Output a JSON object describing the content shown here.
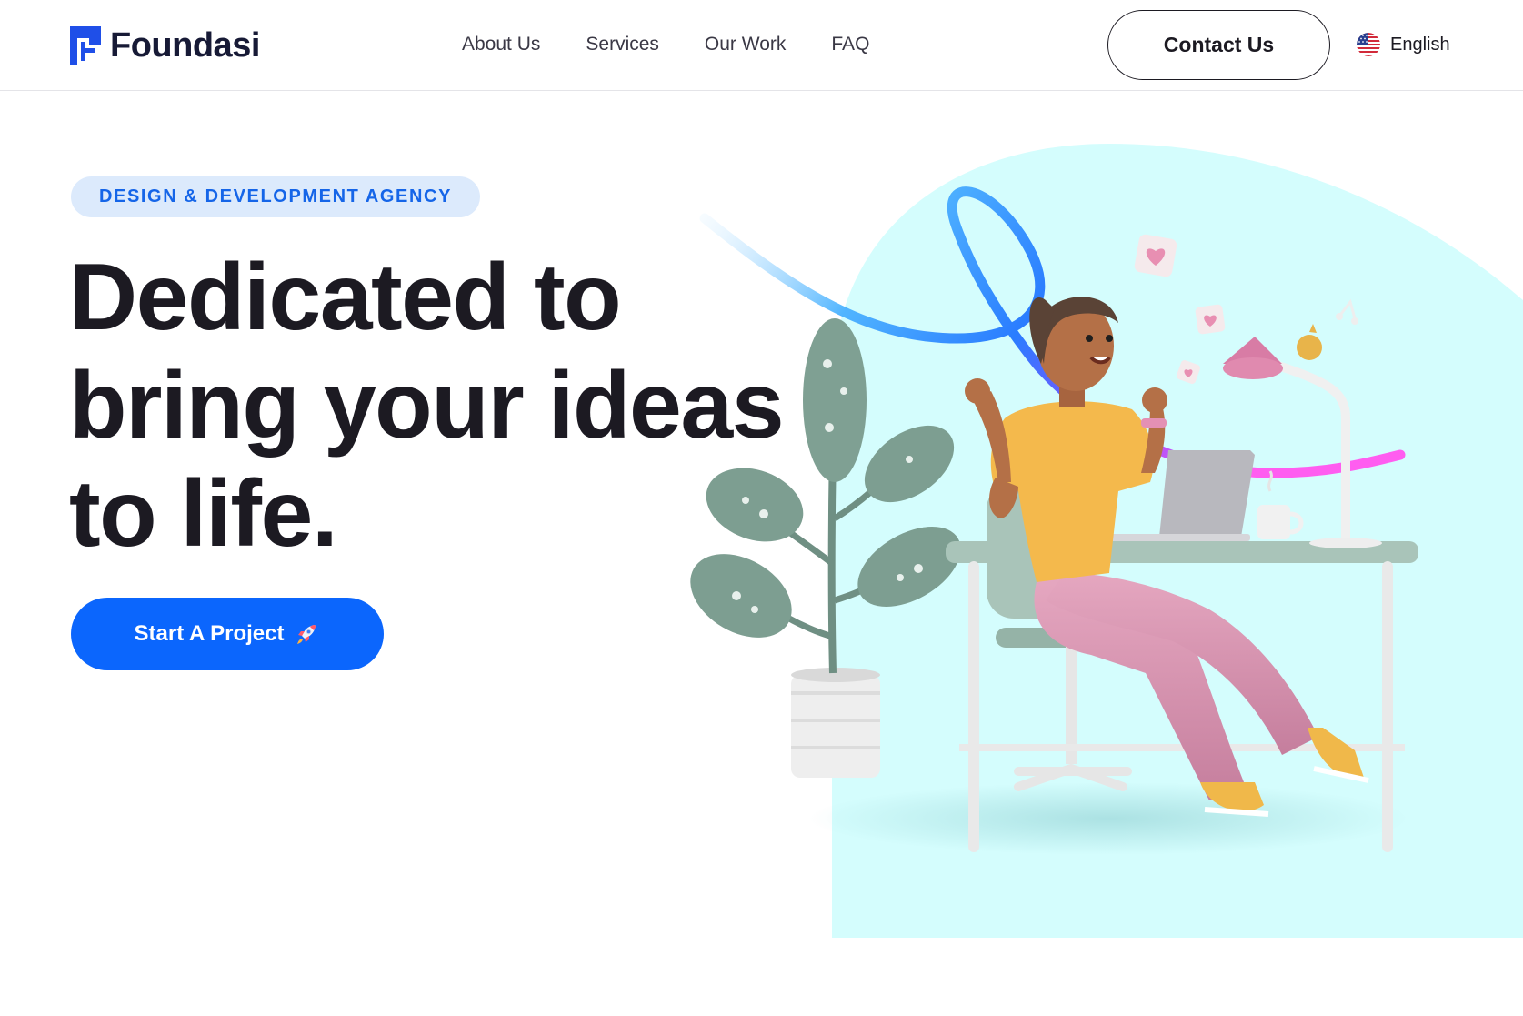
{
  "brand": {
    "name": "Foundasi",
    "logo_icon": "foundasi-f-mark-icon",
    "color": "#171a36"
  },
  "nav": {
    "items": [
      {
        "label": "About Us"
      },
      {
        "label": "Services"
      },
      {
        "label": "Our Work"
      },
      {
        "label": "FAQ"
      }
    ]
  },
  "header": {
    "contact_label": "Contact Us",
    "language": {
      "label": "English",
      "flag_icon": "us-flag-icon"
    }
  },
  "hero": {
    "tagline": "DESIGN & DEVELOPMENT AGENCY",
    "title_lines": [
      "Dedicated to",
      "bring your ideas",
      "to life."
    ],
    "cta_label": "Start A Project",
    "cta_icon": "rocket-icon"
  },
  "illustration": {
    "subject": "woman-at-desk-with-laptop-illustration",
    "background_color": "#d4fdfd"
  },
  "colors": {
    "accent": "#0b66fd",
    "tagline_bg": "#dceafc",
    "tagline_text": "#1565e8",
    "text": "#1c1a22"
  }
}
